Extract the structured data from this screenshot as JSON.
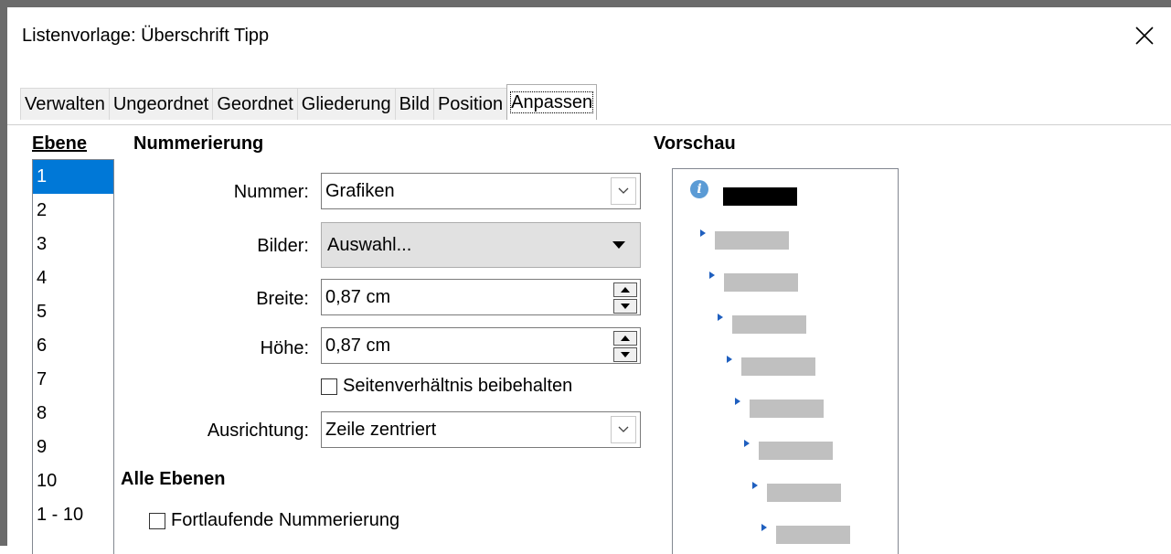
{
  "dialog": {
    "title": "Listenvorlage: Überschrift Tipp"
  },
  "tabs": [
    {
      "label": "Verwalten"
    },
    {
      "label": "Ungeordnet"
    },
    {
      "label": "Geordnet"
    },
    {
      "label": "Gliederung"
    },
    {
      "label": "Bild"
    },
    {
      "label": "Position"
    },
    {
      "label": "Anpassen",
      "active": true
    }
  ],
  "levels": {
    "heading": "Ebene",
    "items": [
      "1",
      "2",
      "3",
      "4",
      "5",
      "6",
      "7",
      "8",
      "9",
      "10",
      "1 - 10"
    ],
    "selected": "1"
  },
  "numbering": {
    "heading": "Nummerierung",
    "number_label": "Nummer:",
    "number_value": "Grafiken",
    "images_label": "Bilder:",
    "images_value": "Auswahl...",
    "width_label": "Breite:",
    "width_value": "0,87 cm",
    "height_label": "Höhe:",
    "height_value": "0,87 cm",
    "keep_ratio_label": "Seitenverhältnis beibehalten",
    "keep_ratio_checked": false,
    "alignment_label": "Ausrichtung:",
    "alignment_value": "Zeile zentriert"
  },
  "all_levels": {
    "heading": "Alle Ebenen",
    "continuous_label": "Fortlaufende Nummerierung",
    "continuous_checked": false
  },
  "preview": {
    "heading": "Vorschau"
  },
  "colors": {
    "selection": "#0078d7",
    "info_icon": "#5b9bd5",
    "bullet": "#1f5fbf"
  },
  "icons": {
    "close": "close-icon",
    "info": "info-icon"
  }
}
